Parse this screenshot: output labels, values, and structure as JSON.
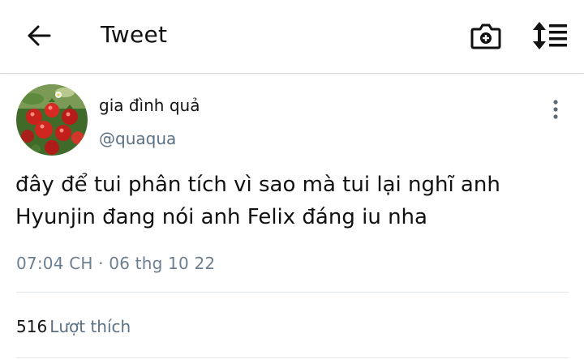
{
  "header": {
    "title": "Tweet",
    "back_icon": "arrow-left-icon",
    "camera_icon": "camera-plus-icon",
    "sort_icon": "sort-list-icon"
  },
  "tweet": {
    "display_name": "gia đình quả",
    "handle": "@quaqua",
    "text": "đây để tui phân tích vì sao mà tui lại nghĩ anh\nHyunjin đang nói anh Felix đáng iu nha",
    "timestamp": "07:04 CH · 06 thg 10 22",
    "likes_count": "516",
    "likes_label": "Lượt thích",
    "more_icon": "more-vertical-icon",
    "avatar_icon": "strawberries-avatar"
  },
  "colors": {
    "text_primary": "#111111",
    "text_secondary": "#5b7083",
    "divider": "#e1e6ea"
  }
}
